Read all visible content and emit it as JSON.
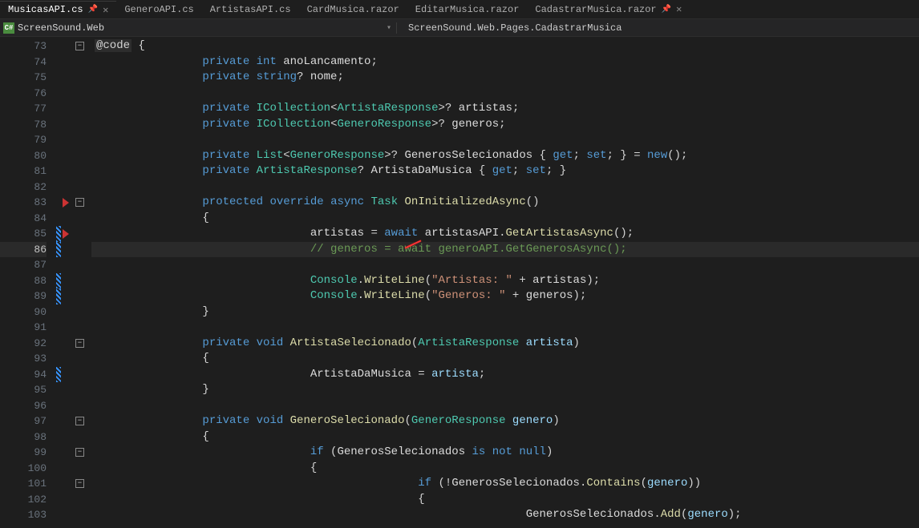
{
  "tabs": [
    {
      "name": "MusicasAPI.cs",
      "pinned": true,
      "close": true,
      "active": true
    },
    {
      "name": "GeneroAPI.cs"
    },
    {
      "name": "ArtistasAPI.cs"
    },
    {
      "name": "CardMusica.razor"
    },
    {
      "name": "EditarMusica.razor"
    },
    {
      "name": "CadastrarMusica.razor",
      "pinned": true,
      "close": true
    }
  ],
  "context": {
    "left_icon": "C#",
    "left": "ScreenSound.Web",
    "right": "ScreenSound.Web.Pages.CadastrarMusica"
  },
  "lines": [
    {
      "num": 73,
      "markers": [
        "fold"
      ]
    },
    {
      "num": 74
    },
    {
      "num": 75
    },
    {
      "num": 76
    },
    {
      "num": 77
    },
    {
      "num": 78
    },
    {
      "num": 79
    },
    {
      "num": 80
    },
    {
      "num": 81
    },
    {
      "num": 82
    },
    {
      "num": 83,
      "markers": [
        "bp",
        "fold"
      ]
    },
    {
      "num": 84
    },
    {
      "num": 85,
      "markers": [
        "change",
        "bp"
      ]
    },
    {
      "num": 86,
      "active": true,
      "markers": [
        "change"
      ]
    },
    {
      "num": 87
    },
    {
      "num": 88,
      "markers": [
        "change"
      ]
    },
    {
      "num": 89,
      "markers": [
        "change"
      ]
    },
    {
      "num": 90
    },
    {
      "num": 91
    },
    {
      "num": 92,
      "markers": [
        "fold"
      ]
    },
    {
      "num": 93
    },
    {
      "num": 94,
      "markers": [
        "change"
      ]
    },
    {
      "num": 95
    },
    {
      "num": 96
    },
    {
      "num": 97,
      "markers": [
        "fold"
      ]
    },
    {
      "num": 98
    },
    {
      "num": 99,
      "markers": [
        "fold"
      ]
    },
    {
      "num": 100
    },
    {
      "num": 101,
      "markers": [
        "fold"
      ]
    },
    {
      "num": 102
    },
    {
      "num": 103
    }
  ],
  "code": {
    "73": {
      "indent": 0,
      "tokens": [
        [
          "k-dir",
          "@code"
        ],
        [
          "k-punc",
          " {"
        ]
      ]
    },
    "74": {
      "indent": 4,
      "tokens": [
        [
          "k-blue",
          "private"
        ],
        [
          "",
          ""
        ],
        [
          "k-blue",
          " int"
        ],
        [
          "k-white",
          " anoLancamento"
        ],
        [
          "k-punc",
          ";"
        ]
      ]
    },
    "75": {
      "indent": 4,
      "tokens": [
        [
          "k-blue",
          "private"
        ],
        [
          "k-blue",
          " string"
        ],
        [
          "k-punc",
          "?"
        ],
        [
          "k-white",
          " nome"
        ],
        [
          "k-punc",
          ";"
        ]
      ]
    },
    "76": {
      "indent": 0,
      "tokens": []
    },
    "77": {
      "indent": 4,
      "tokens": [
        [
          "k-blue",
          "private"
        ],
        [
          "k-type",
          " ICollection"
        ],
        [
          "k-punc",
          "<"
        ],
        [
          "k-type",
          "ArtistaResponse"
        ],
        [
          "k-punc",
          ">?"
        ],
        [
          "k-white",
          " artistas"
        ],
        [
          "k-punc",
          ";"
        ]
      ]
    },
    "78": {
      "indent": 4,
      "tokens": [
        [
          "k-blue",
          "private"
        ],
        [
          "k-type",
          " ICollection"
        ],
        [
          "k-punc",
          "<"
        ],
        [
          "k-type",
          "GeneroResponse"
        ],
        [
          "k-punc",
          ">?"
        ],
        [
          "k-white",
          " generos"
        ],
        [
          "k-punc",
          ";"
        ]
      ]
    },
    "79": {
      "indent": 0,
      "tokens": []
    },
    "80": {
      "indent": 4,
      "tokens": [
        [
          "k-blue",
          "private"
        ],
        [
          "k-type",
          " List"
        ],
        [
          "k-punc",
          "<"
        ],
        [
          "k-type",
          "GeneroResponse"
        ],
        [
          "k-punc",
          ">?"
        ],
        [
          "k-white",
          " GenerosSelecionados"
        ],
        [
          "k-punc",
          " { "
        ],
        [
          "k-blue",
          "get"
        ],
        [
          "k-punc",
          "; "
        ],
        [
          "k-blue",
          "set"
        ],
        [
          "k-punc",
          "; } = "
        ],
        [
          "k-blue",
          "new"
        ],
        [
          "k-punc",
          "();"
        ]
      ]
    },
    "81": {
      "indent": 4,
      "tokens": [
        [
          "k-blue",
          "private"
        ],
        [
          "k-type",
          " ArtistaResponse"
        ],
        [
          "k-punc",
          "?"
        ],
        [
          "k-white",
          " ArtistaDaMusica"
        ],
        [
          "k-punc",
          " { "
        ],
        [
          "k-blue",
          "get"
        ],
        [
          "k-punc",
          "; "
        ],
        [
          "k-blue",
          "set"
        ],
        [
          "k-punc",
          "; }"
        ]
      ]
    },
    "82": {
      "indent": 0,
      "tokens": []
    },
    "83": {
      "indent": 4,
      "tokens": [
        [
          "k-blue",
          "protected"
        ],
        [
          "k-blue",
          " override"
        ],
        [
          "k-blue",
          " async"
        ],
        [
          "k-type",
          " Task"
        ],
        [
          "k-meth",
          " OnInitializedAsync"
        ],
        [
          "k-punc",
          "()"
        ]
      ]
    },
    "84": {
      "indent": 4,
      "tokens": [
        [
          "k-punc",
          "{"
        ]
      ]
    },
    "85": {
      "indent": 8,
      "tokens": [
        [
          "k-white",
          "artistas"
        ],
        [
          "k-punc",
          " = "
        ],
        [
          "k-blue",
          "await"
        ],
        [
          "k-white",
          " artistasAPI"
        ],
        [
          "k-punc",
          "."
        ],
        [
          "k-meth",
          "GetArtistasAsync"
        ],
        [
          "k-punc",
          "();"
        ]
      ]
    },
    "86": {
      "indent": 8,
      "tokens": [
        [
          "k-comment",
          "// generos = await generoAPI.GetGenerosAsync();"
        ]
      ]
    },
    "87": {
      "indent": 0,
      "tokens": []
    },
    "88": {
      "indent": 8,
      "tokens": [
        [
          "k-type",
          "Console"
        ],
        [
          "k-punc",
          "."
        ],
        [
          "k-meth",
          "WriteLine"
        ],
        [
          "k-punc",
          "("
        ],
        [
          "k-str",
          "\"Artistas: \""
        ],
        [
          "k-punc",
          " + "
        ],
        [
          "k-white",
          "artistas"
        ],
        [
          "k-punc",
          ");"
        ]
      ]
    },
    "89": {
      "indent": 8,
      "tokens": [
        [
          "k-type",
          "Console"
        ],
        [
          "k-punc",
          "."
        ],
        [
          "k-meth",
          "WriteLine"
        ],
        [
          "k-punc",
          "("
        ],
        [
          "k-str",
          "\"Generos: \""
        ],
        [
          "k-punc",
          " + "
        ],
        [
          "k-white",
          "generos"
        ],
        [
          "k-punc",
          ");"
        ]
      ]
    },
    "90": {
      "indent": 4,
      "tokens": [
        [
          "k-punc",
          "}"
        ]
      ]
    },
    "91": {
      "indent": 0,
      "tokens": []
    },
    "92": {
      "indent": 4,
      "tokens": [
        [
          "k-blue",
          "private"
        ],
        [
          "k-blue",
          " void"
        ],
        [
          "k-meth",
          " ArtistaSelecionado"
        ],
        [
          "k-punc",
          "("
        ],
        [
          "k-type",
          "ArtistaResponse"
        ],
        [
          "k-var",
          " artista"
        ],
        [
          "k-punc",
          ")"
        ]
      ]
    },
    "93": {
      "indent": 4,
      "tokens": [
        [
          "k-punc",
          "{"
        ]
      ]
    },
    "94": {
      "indent": 8,
      "tokens": [
        [
          "k-white",
          "ArtistaDaMusica"
        ],
        [
          "k-punc",
          " = "
        ],
        [
          "k-var",
          "artista"
        ],
        [
          "k-punc",
          ";"
        ]
      ]
    },
    "95": {
      "indent": 4,
      "tokens": [
        [
          "k-punc",
          "}"
        ]
      ]
    },
    "96": {
      "indent": 0,
      "tokens": []
    },
    "97": {
      "indent": 4,
      "tokens": [
        [
          "k-blue",
          "private"
        ],
        [
          "k-blue",
          " void"
        ],
        [
          "k-meth",
          " GeneroSelecionado"
        ],
        [
          "k-punc",
          "("
        ],
        [
          "k-type",
          "GeneroResponse"
        ],
        [
          "k-var",
          " genero"
        ],
        [
          "k-punc",
          ")"
        ]
      ]
    },
    "98": {
      "indent": 4,
      "tokens": [
        [
          "k-punc",
          "{"
        ]
      ]
    },
    "99": {
      "indent": 8,
      "tokens": [
        [
          "k-blue",
          "if"
        ],
        [
          "k-punc",
          " ("
        ],
        [
          "k-white",
          "GenerosSelecionados"
        ],
        [
          "k-blue",
          " is not null"
        ],
        [
          "k-punc",
          ")"
        ]
      ]
    },
    "100": {
      "indent": 8,
      "tokens": [
        [
          "k-punc",
          "{"
        ]
      ]
    },
    "101": {
      "indent": 12,
      "tokens": [
        [
          "k-blue",
          "if"
        ],
        [
          "k-punc",
          " (!"
        ],
        [
          "k-white",
          "GenerosSelecionados"
        ],
        [
          "k-punc",
          "."
        ],
        [
          "k-meth",
          "Contains"
        ],
        [
          "k-punc",
          "("
        ],
        [
          "k-var",
          "genero"
        ],
        [
          "k-punc",
          "))"
        ]
      ]
    },
    "102": {
      "indent": 12,
      "tokens": [
        [
          "k-punc",
          "{"
        ]
      ]
    },
    "103": {
      "indent": 16,
      "tokens": [
        [
          "k-white",
          "GenerosSelecionados"
        ],
        [
          "k-punc",
          "."
        ],
        [
          "k-meth",
          "Add"
        ],
        [
          "k-punc",
          "("
        ],
        [
          "k-var",
          "genero"
        ],
        [
          "k-punc",
          ");"
        ]
      ]
    }
  }
}
